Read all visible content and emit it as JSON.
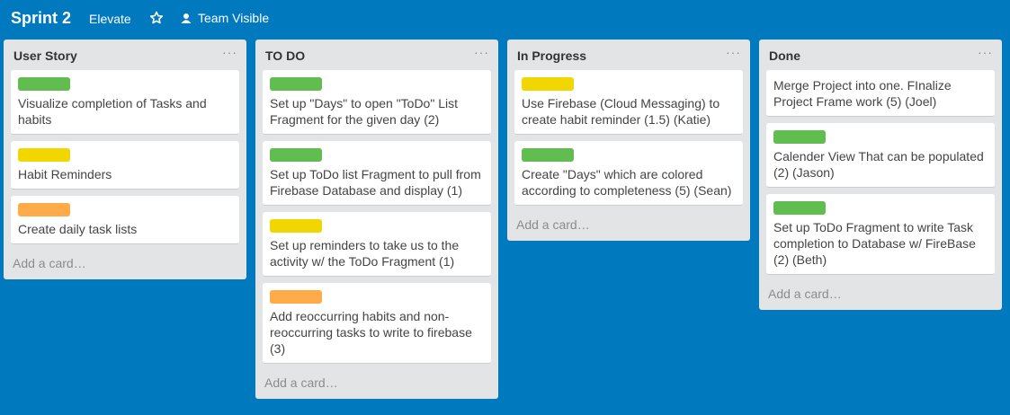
{
  "header": {
    "board_title": "Sprint 2",
    "org": "Elevate",
    "star_icon": "star-icon",
    "visibility_label": "Team Visible",
    "visibility_icon": "team-icon"
  },
  "colors": {
    "green": "#61bd4f",
    "yellow": "#f2d600",
    "orange": "#ffab4a"
  },
  "lists": [
    {
      "title": "User Story",
      "menu": "···",
      "add_card": "Add a card…",
      "cards": [
        {
          "label": "green",
          "text": "Visualize completion of Tasks and habits"
        },
        {
          "label": "yellow",
          "text": "Habit Reminders"
        },
        {
          "label": "orange",
          "text": "Create daily task lists"
        }
      ]
    },
    {
      "title": "TO DO",
      "menu": "···",
      "add_card": "Add a card…",
      "cards": [
        {
          "label": "green",
          "text": "Set up \"Days\" to open \"ToDo\" List Fragment for the given day (2)"
        },
        {
          "label": "green",
          "text": "Set up ToDo list Fragment to pull from Firebase Database and display (1)"
        },
        {
          "label": "yellow",
          "text": "Set up reminders to take us to the activity w/ the ToDo Fragment (1)"
        },
        {
          "label": "orange",
          "text": "Add reoccurring habits and non-reoccurring tasks to write to firebase (3)"
        }
      ]
    },
    {
      "title": "In Progress",
      "menu": "···",
      "add_card": "Add a card…",
      "cards": [
        {
          "label": "yellow",
          "text": "Use Firebase (Cloud Messaging) to create habit reminder (1.5) (Katie)"
        },
        {
          "label": "green",
          "text": "Create \"Days\" which are colored according to completeness (5) (Sean)"
        }
      ]
    },
    {
      "title": "Done",
      "menu": "···",
      "add_card": "Add a card…",
      "cards": [
        {
          "label": "",
          "text": "Merge Project into one. FInalize Project Frame work (5) (Joel)"
        },
        {
          "label": "green",
          "text": "Calender View That can be populated (2) (Jason)"
        },
        {
          "label": "green",
          "text": "Set up ToDo Fragment to write Task completion to Database w/ FireBase (2) (Beth)"
        }
      ]
    }
  ]
}
